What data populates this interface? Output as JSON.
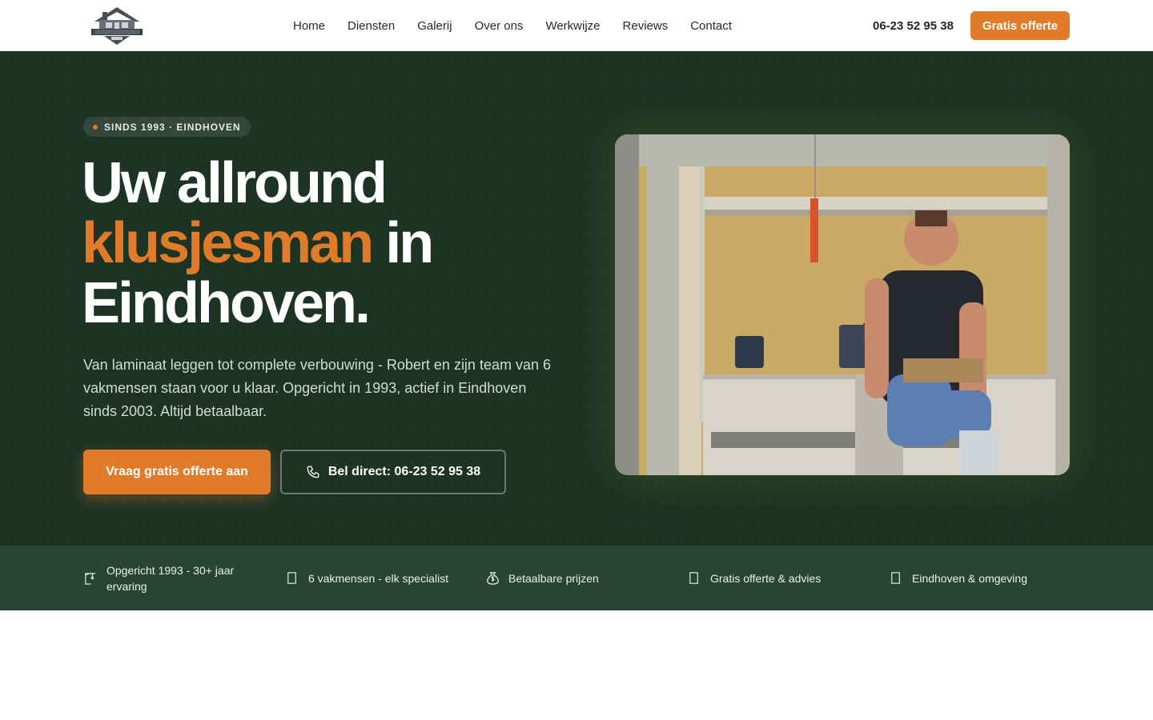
{
  "nav": {
    "logo_alt": "Klusjesman Robert B.V.",
    "links": [
      "Home",
      "Diensten",
      "Galerij",
      "Over ons",
      "Werkwijze",
      "Reviews",
      "Contact"
    ],
    "phone": "06-23 52 95 38",
    "cta": "Gratis offerte"
  },
  "hero": {
    "badge": "SINDS 1993 · EINDHOVEN",
    "headline_line1": "Uw allround",
    "headline_accent": "klusjesman",
    "headline_mid": " in",
    "headline_line3": "Eindhoven.",
    "subtitle": "Van laminaat leggen tot complete verbouwing - Robert en zijn team van 6 vakmensen staan voor u klaar. Opgericht in 1993, actief in Eindhoven sinds 2003. Altijd betaalbaar.",
    "primary_cta": "Vraag gratis offerte aan",
    "secondary_cta": "Bel direct: 06-23 52 95 38"
  },
  "features": [
    {
      "icon": "crane-icon",
      "text": "Opgericht 1993 - 30+ jaar ervaring"
    },
    {
      "icon": "team-icon",
      "text": "6 vakmensen - elk specialist"
    },
    {
      "icon": "money-bag-icon",
      "text": "Betaalbare prijzen"
    },
    {
      "icon": "document-icon",
      "text": "Gratis offerte & advies"
    },
    {
      "icon": "location-pin-icon",
      "text": "Eindhoven & omgeving"
    }
  ],
  "colors": {
    "accent": "#e07b2a",
    "hero_bg": "#1d3324",
    "feature_bar_bg": "#264535"
  }
}
